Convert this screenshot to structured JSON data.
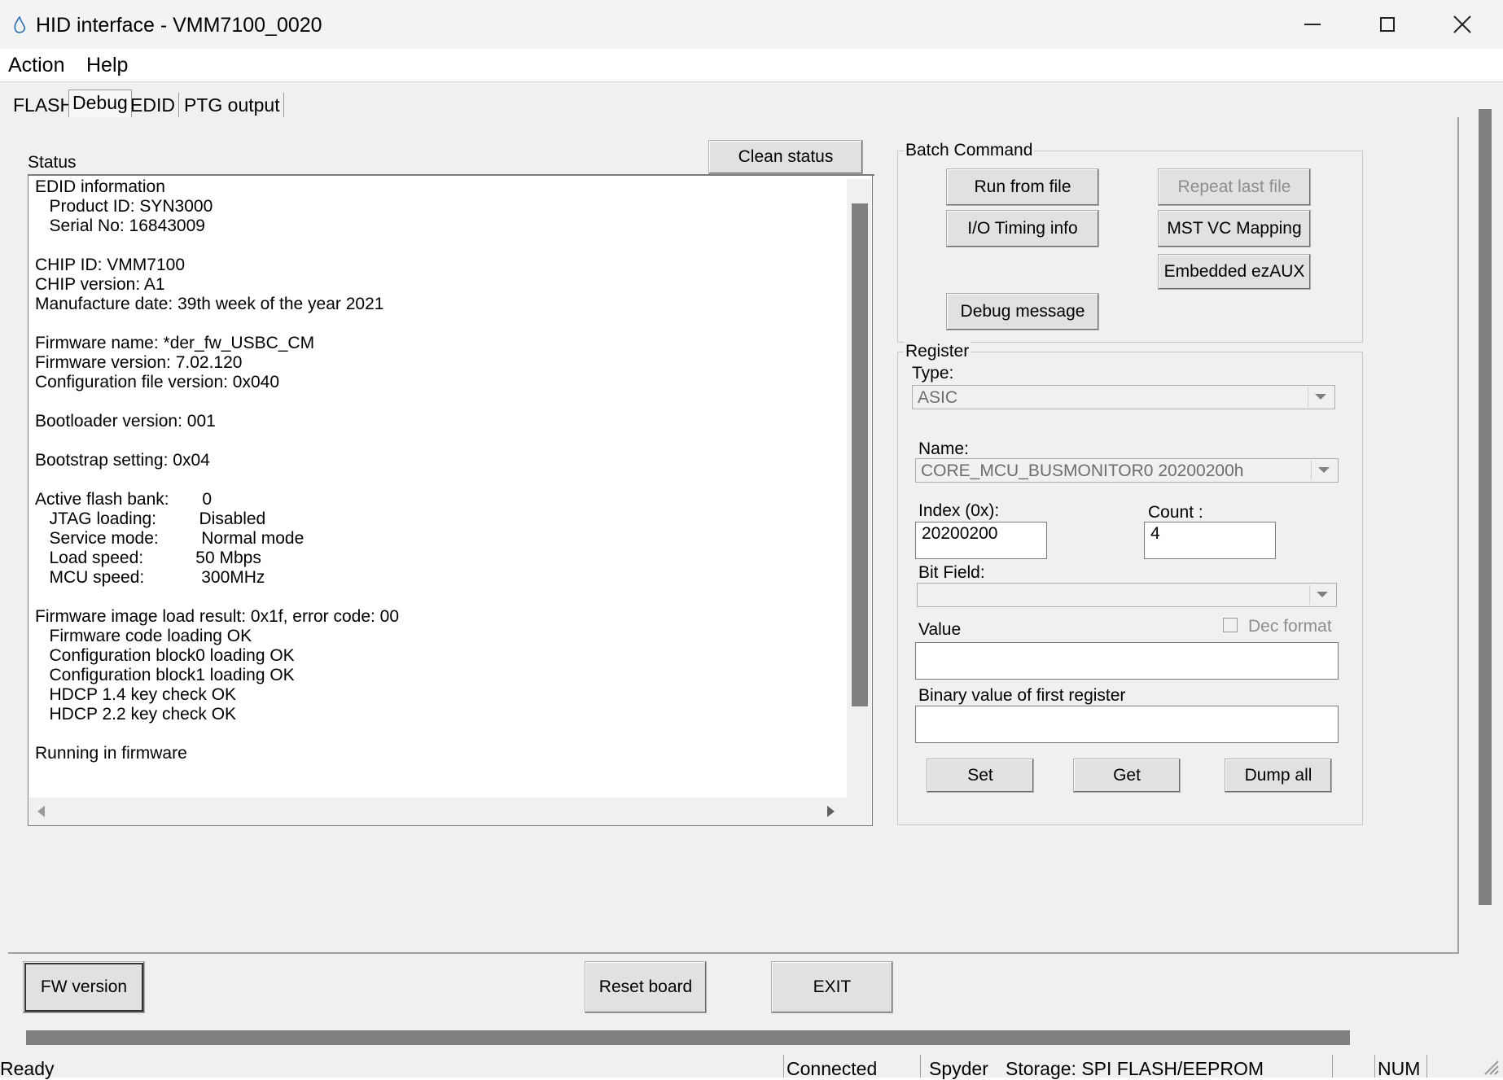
{
  "window": {
    "title": "HID interface - VMM7100_0020",
    "minimize_glyph": "─",
    "maximize_glyph": "☐",
    "close_glyph": "✕"
  },
  "menu": [
    "Action",
    "Help"
  ],
  "tabs": [
    {
      "label": "FLASH",
      "selected": false
    },
    {
      "label": "Debug",
      "selected": true
    },
    {
      "label": "EDID",
      "selected": false
    },
    {
      "label": "PTG output",
      "selected": false
    }
  ],
  "status": {
    "label": "Status",
    "clean_button": "Clean status",
    "text": "EDID information\n   Product ID: SYN3000\n   Serial No: 16843009\n\nCHIP ID: VMM7100\nCHIP version: A1\nManufacture date: 39th week of the year 2021\n\nFirmware name: *der_fw_USBC_CM\nFirmware version: 7.02.120\nConfiguration file version: 0x040\n\nBootloader version: 001\n\nBootstrap setting: 0x04\n\nActive flash bank:       0\n   JTAG loading:         Disabled\n   Service mode:         Normal mode\n   Load speed:           50 Mbps\n   MCU speed:            300MHz\n\nFirmware image load result: 0x1f, error code: 00\n   Firmware code loading OK\n   Configuration block0 loading OK\n   Configuration block1 loading OK\n   HDCP 1.4 key check OK\n   HDCP 2.2 key check OK\n\nRunning in firmware"
  },
  "batch": {
    "title": "Batch Command",
    "run_from_file": "Run from file",
    "repeat_last_file": "Repeat last file",
    "io_timing": "I/O Timing info",
    "mst_vc": "MST VC Mapping",
    "embedded_ezaux": "Embedded ezAUX",
    "debug_message": "Debug message"
  },
  "register": {
    "title": "Register",
    "type_label": "Type:",
    "type_value": "ASIC",
    "name_label": "Name:",
    "name_value": "CORE_MCU_BUSMONITOR0  20200200h",
    "index_label": "Index (0x):",
    "index_value": "20200200",
    "count_label": "Count :",
    "count_value": "4",
    "bitfield_label": "Bit Field:",
    "bitfield_value": "",
    "value_label": "Value",
    "value_value": "",
    "dec_format_label": "Dec format",
    "binary_label": "Binary value of first register",
    "binary_value": "",
    "set": "Set",
    "get": "Get",
    "dump_all": "Dump all"
  },
  "footer_buttons": {
    "fw_version": "FW version",
    "reset_board": "Reset board",
    "exit": "EXIT"
  },
  "statusbar": {
    "ready": "Ready",
    "connected": "Connected",
    "spyder": "Spyder",
    "storage": "Storage: SPI FLASH/EEPROM",
    "num": "NUM"
  }
}
